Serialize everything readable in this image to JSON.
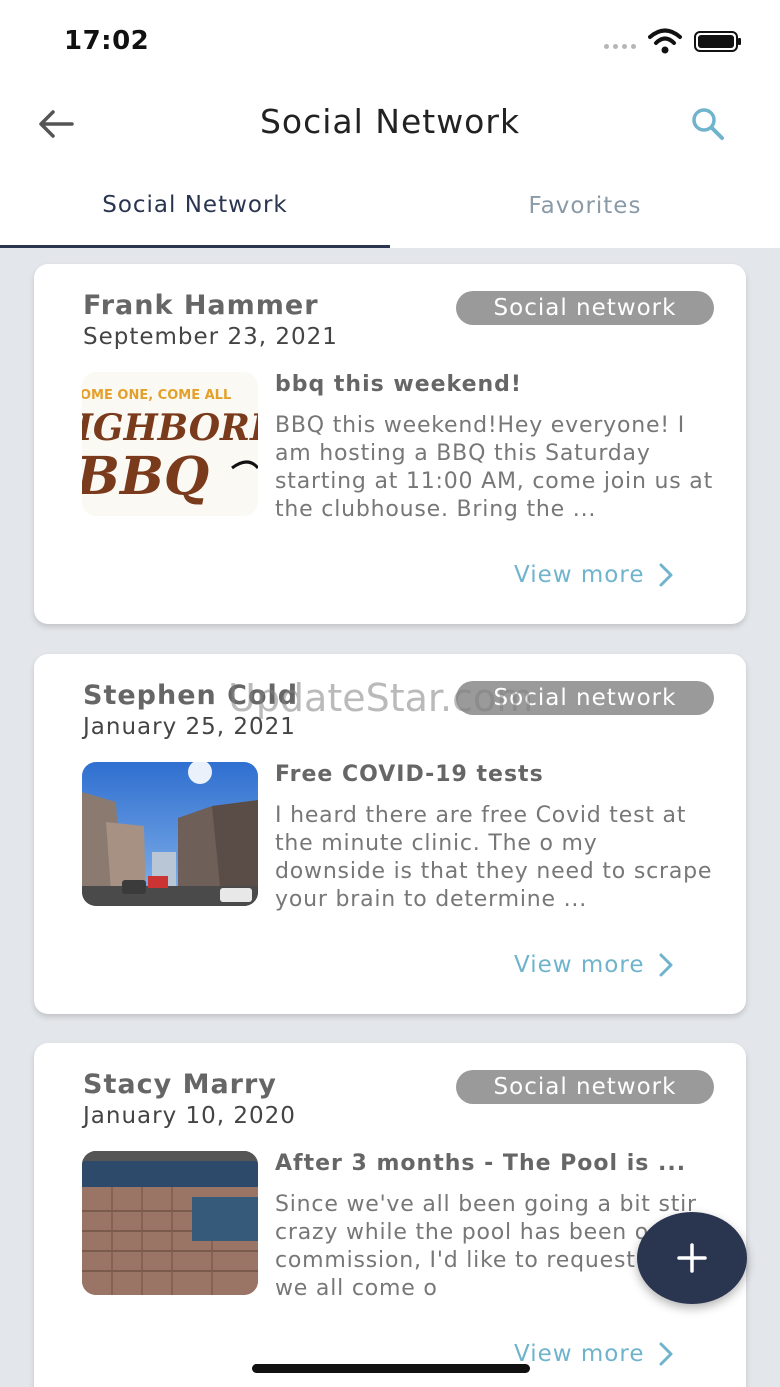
{
  "status_bar": {
    "time": "17:02"
  },
  "nav": {
    "title": "Social Network",
    "back_icon": "arrow-left-icon",
    "search_icon": "search-icon"
  },
  "tabs": [
    {
      "label": "Social Network",
      "active": true
    },
    {
      "label": "Favorites",
      "active": false
    }
  ],
  "posts": [
    {
      "author": "Frank Hammer",
      "date": "September 23, 2021",
      "tag": "Social network",
      "title": "bbq this weekend!",
      "body": "BBQ this weekend!Hey everyone! I am hosting a BBQ this Saturday starting at 11:00 AM, come join us at the clubhouse. Bring the ...",
      "image_text_top": "OME ONE, COME ALL",
      "image_text_main": "IGHBORH",
      "image_text_bottom": "BBQ",
      "link": "View more"
    },
    {
      "author": "Stephen Cold",
      "date": "January 25, 2021",
      "tag": "Social network",
      "title": "Free COVID-19 tests",
      "body": "I heard there are free Covid test at the minute clinic. The o my downside is that they need to scrape your brain to determine ...",
      "link": "View more"
    },
    {
      "author": "Stacy Marry",
      "date": "January 10, 2020",
      "tag": "Social network",
      "title": "After 3 months - The Pool is ...",
      "body": "Since we've all been going a bit stir crazy while the pool has been out of commission, I'd like to request that we all come o",
      "link": "View more"
    }
  ],
  "fab": {
    "icon": "plus-icon"
  },
  "watermark": "UpdateStar.com",
  "colors": {
    "primary": "#2a3550",
    "accent": "#6fb3cc",
    "badge": "#9a9a9a",
    "background": "#e3e6ea"
  }
}
